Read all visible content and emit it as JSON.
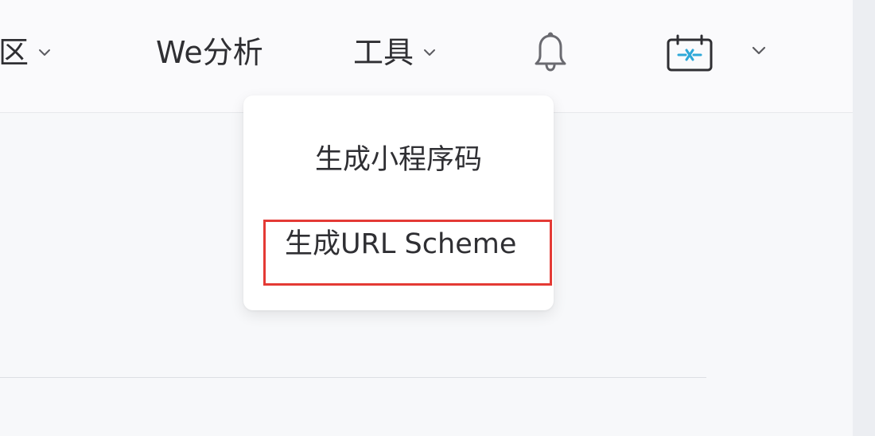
{
  "topbar": {
    "nav": [
      {
        "label": "区"
      },
      {
        "label": "We分析"
      },
      {
        "label": "工具"
      }
    ]
  },
  "dropdown": {
    "items": [
      {
        "label": "生成小程序码"
      },
      {
        "label": "生成URL Scheme"
      }
    ]
  },
  "colors": {
    "highlight": "#e43a35"
  },
  "icons": {
    "bell": "bell-icon",
    "calendar": "calendar-icon",
    "chevron": "chevron-down-icon"
  }
}
